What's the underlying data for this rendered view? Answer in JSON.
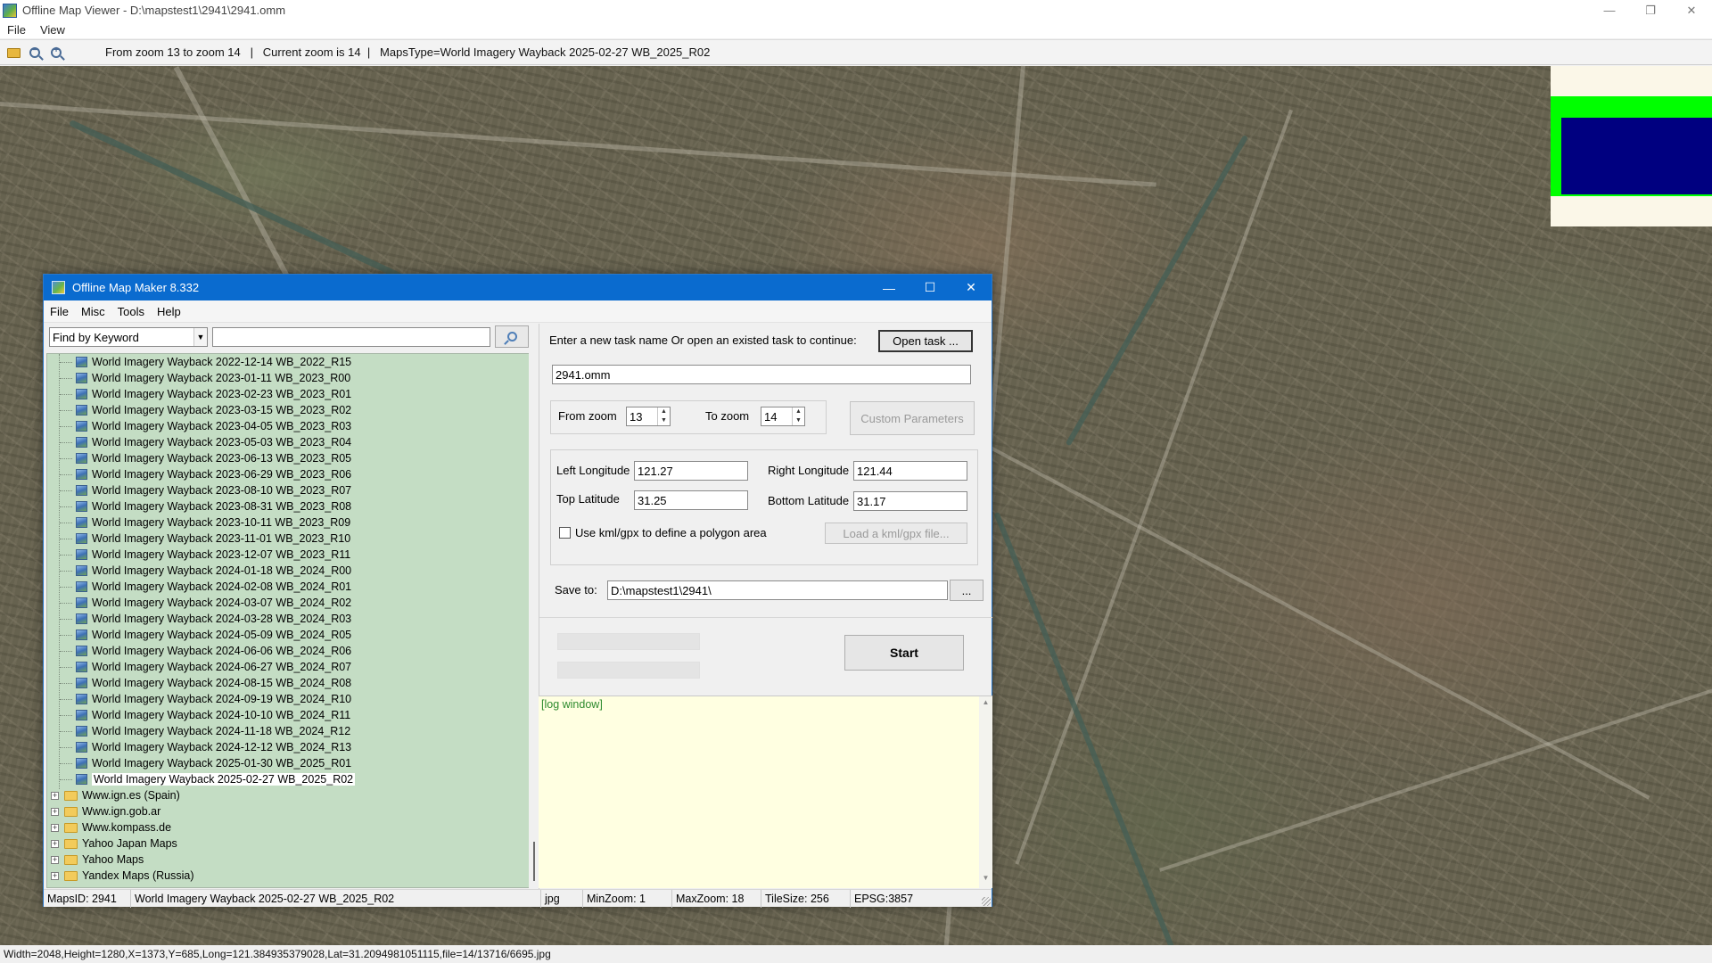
{
  "viewer": {
    "title": "Offline Map Viewer - D:\\mapstest1\\2941\\2941.omm",
    "menu": [
      "File",
      "View"
    ],
    "toolbar_status": "From zoom 13 to zoom 14   |   Current zoom is 14  |   MapsType=World Imagery Wayback 2025-02-27 WB_2025_R02",
    "zoom_out_symbol": "−",
    "zoom_in_symbol": "+",
    "controls": {
      "minimize": "—",
      "maximize": "❐",
      "close": "✕"
    },
    "bottom_status": "Width=2048,Height=1280,X=1373,Y=685,Long=121.384935379028,Lat=31.2094981051115,file=14/13716/6695.jpg"
  },
  "minimap_colors": {
    "background": "#fbf7e8",
    "frame": "#00ff00",
    "view": "#000080"
  },
  "dialog": {
    "title": "Offline Map Maker 8.332",
    "controls": {
      "minimize": "—",
      "maximize": "☐",
      "close": "✕"
    },
    "menu": [
      "File",
      "Misc",
      "Tools",
      "Help"
    ],
    "find": {
      "mode": "Find by Keyword",
      "query": "",
      "dropdown_arrow": "▼"
    },
    "tree": {
      "children": [
        "World Imagery Wayback 2022-12-14 WB_2022_R15",
        "World Imagery Wayback 2023-01-11 WB_2023_R00",
        "World Imagery Wayback 2023-02-23 WB_2023_R01",
        "World Imagery Wayback 2023-03-15 WB_2023_R02",
        "World Imagery Wayback 2023-04-05 WB_2023_R03",
        "World Imagery Wayback 2023-05-03 WB_2023_R04",
        "World Imagery Wayback 2023-06-13 WB_2023_R05",
        "World Imagery Wayback 2023-06-29 WB_2023_R06",
        "World Imagery Wayback 2023-08-10 WB_2023_R07",
        "World Imagery Wayback 2023-08-31 WB_2023_R08",
        "World Imagery Wayback 2023-10-11 WB_2023_R09",
        "World Imagery Wayback 2023-11-01 WB_2023_R10",
        "World Imagery Wayback 2023-12-07 WB_2023_R11",
        "World Imagery Wayback 2024-01-18 WB_2024_R00",
        "World Imagery Wayback 2024-02-08 WB_2024_R01",
        "World Imagery Wayback 2024-03-07 WB_2024_R02",
        "World Imagery Wayback 2024-03-28 WB_2024_R03",
        "World Imagery Wayback 2024-05-09 WB_2024_R05",
        "World Imagery Wayback 2024-06-06 WB_2024_R06",
        "World Imagery Wayback 2024-06-27 WB_2024_R07",
        "World Imagery Wayback 2024-08-15 WB_2024_R08",
        "World Imagery Wayback 2024-09-19 WB_2024_R10",
        "World Imagery Wayback 2024-10-10 WB_2024_R11",
        "World Imagery Wayback 2024-11-18 WB_2024_R12",
        "World Imagery Wayback 2024-12-12 WB_2024_R13",
        "World Imagery Wayback 2025-01-30 WB_2025_R01",
        "World Imagery Wayback 2025-02-27 WB_2025_R02"
      ],
      "selected": "World Imagery Wayback 2025-02-27 WB_2025_R02",
      "folders": [
        "Www.ign.es (Spain)",
        "Www.ign.gob.ar",
        "Www.kompass.de",
        "Yahoo Japan Maps",
        "Yahoo Maps",
        "Yandex Maps (Russia)"
      ],
      "expander_symbol": "+"
    },
    "task": {
      "prompt": "Enter a new task name Or open an existed task to continue:",
      "open_button": "Open task ...",
      "name": "2941.omm"
    },
    "zoom": {
      "from_label": "From zoom",
      "from_value": "13",
      "to_label": "To zoom",
      "to_value": "14",
      "spin_up": "▲",
      "spin_down": "▼",
      "custom_button": "Custom Parameters"
    },
    "bounds": {
      "left_lon_label": "Left Longitude",
      "left_lon": "121.27",
      "right_lon_label": "Right Longitude",
      "right_lon": "121.44",
      "top_lat_label": "Top Latitude",
      "top_lat": "31.25",
      "bottom_lat_label": "Bottom Latitude",
      "bottom_lat": "31.17",
      "polygon_checkbox_label": "Use kml/gpx to define a polygon area",
      "polygon_checked": false,
      "load_button": "Load a kml/gpx file..."
    },
    "save": {
      "label": "Save to:",
      "path": "D:\\mapstest1\\2941\\",
      "browse_button": "..."
    },
    "progress": {
      "bar1_fraction": 0,
      "bar2_fraction": 0
    },
    "start_button": "Start",
    "log": {
      "text": "[log window]",
      "scroll_up": "▲",
      "scroll_down": "▼"
    },
    "status": {
      "maps_id": "MapsID: 2941",
      "maps_name": "World Imagery Wayback 2025-02-27 WB_2025_R02",
      "format": "jpg",
      "min_zoom": "MinZoom: 1",
      "max_zoom": "MaxZoom: 18",
      "tile_size": "TileSize: 256",
      "epsg": "EPSG:3857"
    }
  }
}
